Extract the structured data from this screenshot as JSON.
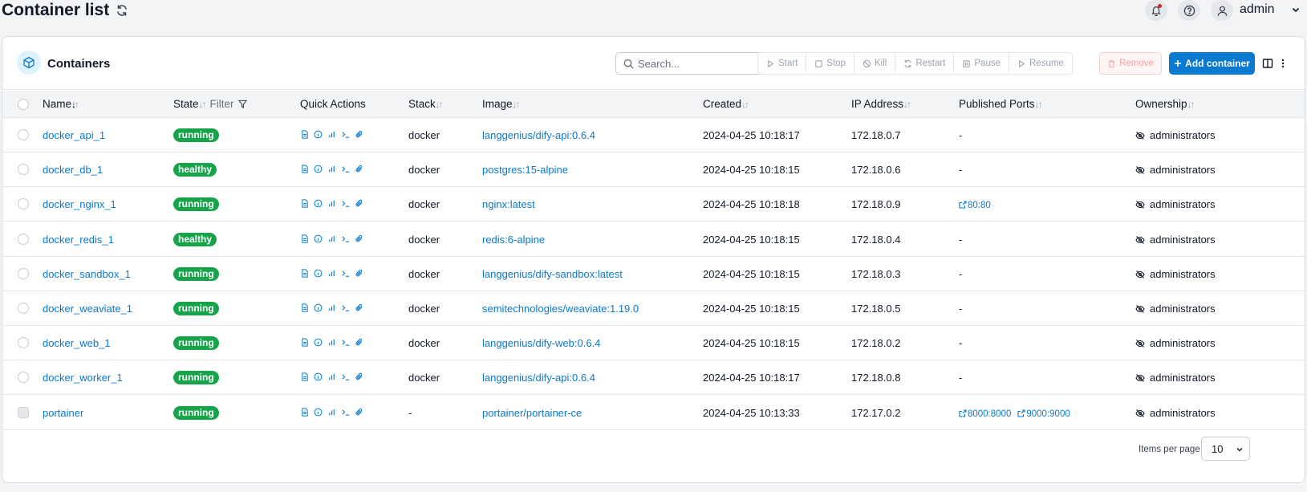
{
  "page": {
    "title": "Container list",
    "user": "admin"
  },
  "card": {
    "title": "Containers",
    "search_placeholder": "Search...",
    "actions": {
      "start": "Start",
      "stop": "Stop",
      "kill": "Kill",
      "restart": "Restart",
      "pause": "Pause",
      "resume": "Resume",
      "remove": "Remove",
      "add": "Add container"
    }
  },
  "table": {
    "headers": {
      "name": "Name",
      "state": "State",
      "filter": "Filter",
      "quick_actions": "Quick Actions",
      "stack": "Stack",
      "image": "Image",
      "created": "Created",
      "ip": "IP Address",
      "ports": "Published Ports",
      "ownership": "Ownership"
    },
    "rows": [
      {
        "name": "docker_api_1",
        "state": "running",
        "stack": "docker",
        "image": "langgenius/dify-api:0.6.4",
        "created": "2024-04-25 10:18:17",
        "ip": "172.18.0.7",
        "ports": [],
        "no_ports": "-",
        "ownership": "administrators"
      },
      {
        "name": "docker_db_1",
        "state": "healthy",
        "stack": "docker",
        "image": "postgres:15-alpine",
        "created": "2024-04-25 10:18:15",
        "ip": "172.18.0.6",
        "ports": [],
        "no_ports": "-",
        "ownership": "administrators"
      },
      {
        "name": "docker_nginx_1",
        "state": "running",
        "stack": "docker",
        "image": "nginx:latest",
        "created": "2024-04-25 10:18:18",
        "ip": "172.18.0.9",
        "ports": [
          "80:80"
        ],
        "no_ports": "",
        "ownership": "administrators"
      },
      {
        "name": "docker_redis_1",
        "state": "healthy",
        "stack": "docker",
        "image": "redis:6-alpine",
        "created": "2024-04-25 10:18:15",
        "ip": "172.18.0.4",
        "ports": [],
        "no_ports": "-",
        "ownership": "administrators"
      },
      {
        "name": "docker_sandbox_1",
        "state": "running",
        "stack": "docker",
        "image": "langgenius/dify-sandbox:latest",
        "created": "2024-04-25 10:18:15",
        "ip": "172.18.0.3",
        "ports": [],
        "no_ports": "-",
        "ownership": "administrators"
      },
      {
        "name": "docker_weaviate_1",
        "state": "running",
        "stack": "docker",
        "image": "semitechnologies/weaviate:1.19.0",
        "created": "2024-04-25 10:18:15",
        "ip": "172.18.0.5",
        "ports": [],
        "no_ports": "-",
        "ownership": "administrators"
      },
      {
        "name": "docker_web_1",
        "state": "running",
        "stack": "docker",
        "image": "langgenius/dify-web:0.6.4",
        "created": "2024-04-25 10:18:15",
        "ip": "172.18.0.2",
        "ports": [],
        "no_ports": "-",
        "ownership": "administrators"
      },
      {
        "name": "docker_worker_1",
        "state": "running",
        "stack": "docker",
        "image": "langgenius/dify-api:0.6.4",
        "created": "2024-04-25 10:18:17",
        "ip": "172.18.0.8",
        "ports": [],
        "no_ports": "-",
        "ownership": "administrators"
      },
      {
        "name": "portainer",
        "state": "running",
        "stack": "-",
        "image": "portainer/portainer-ce",
        "created": "2024-04-25 10:13:33",
        "ip": "172.17.0.2",
        "ports": [
          "8000:8000",
          "9000:9000"
        ],
        "no_ports": "",
        "ownership": "administrators"
      }
    ]
  },
  "footer": {
    "items_per_page_label": "Items per page",
    "items_per_page": "10"
  },
  "colors": {
    "accent": "#0a79d0",
    "state_badge": "#16a34a"
  }
}
